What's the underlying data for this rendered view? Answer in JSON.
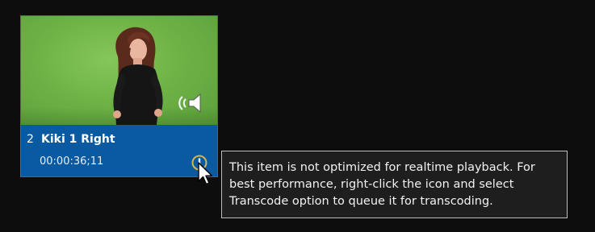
{
  "clip": {
    "number": "2",
    "name": "Kiki 1 Right",
    "duration": "00:00:36;11"
  },
  "icons": {
    "audio": "speaker-icon",
    "warning": "warning-icon",
    "cursor": "mouse-pointer-icon"
  },
  "tooltip": {
    "lines": [
      "This item is not optimized for realtime playback. For",
      "best performance, right-click the icon and select",
      "Transcode option to queue it for transcoding."
    ]
  },
  "colors": {
    "background": "#0d0d0d",
    "clip_label_bg": "#0a5aa2",
    "greenscreen": "#6fb347",
    "warning_ring": "#d4b64a",
    "tooltip_bg": "#1e1e1e"
  }
}
